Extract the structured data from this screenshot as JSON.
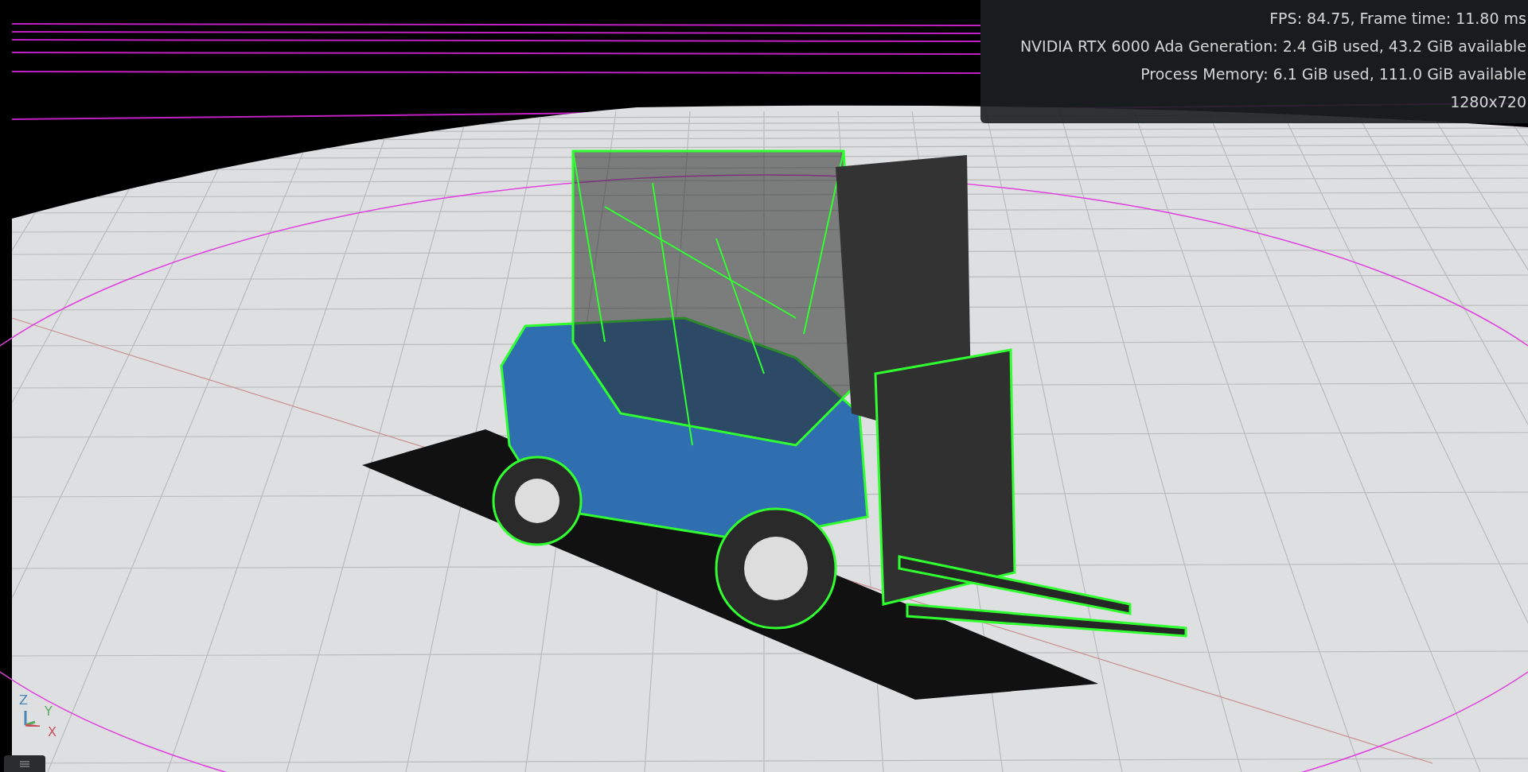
{
  "viewport": {
    "stats": [
      "FPS: 84.75, Frame time: 11.80 ms",
      "NVIDIA RTX 6000 Ada Generation: 2.4 GiB used, 43.2 GiB available",
      "Process Memory: 6.1 GiB used, 111.0 GiB available",
      "1280x720"
    ],
    "axes": [
      {
        "label": "Z",
        "color": "#4a86b8"
      },
      {
        "label": "Y",
        "color": "#5aa860"
      },
      {
        "label": "X",
        "color": "#c8525a"
      }
    ]
  }
}
